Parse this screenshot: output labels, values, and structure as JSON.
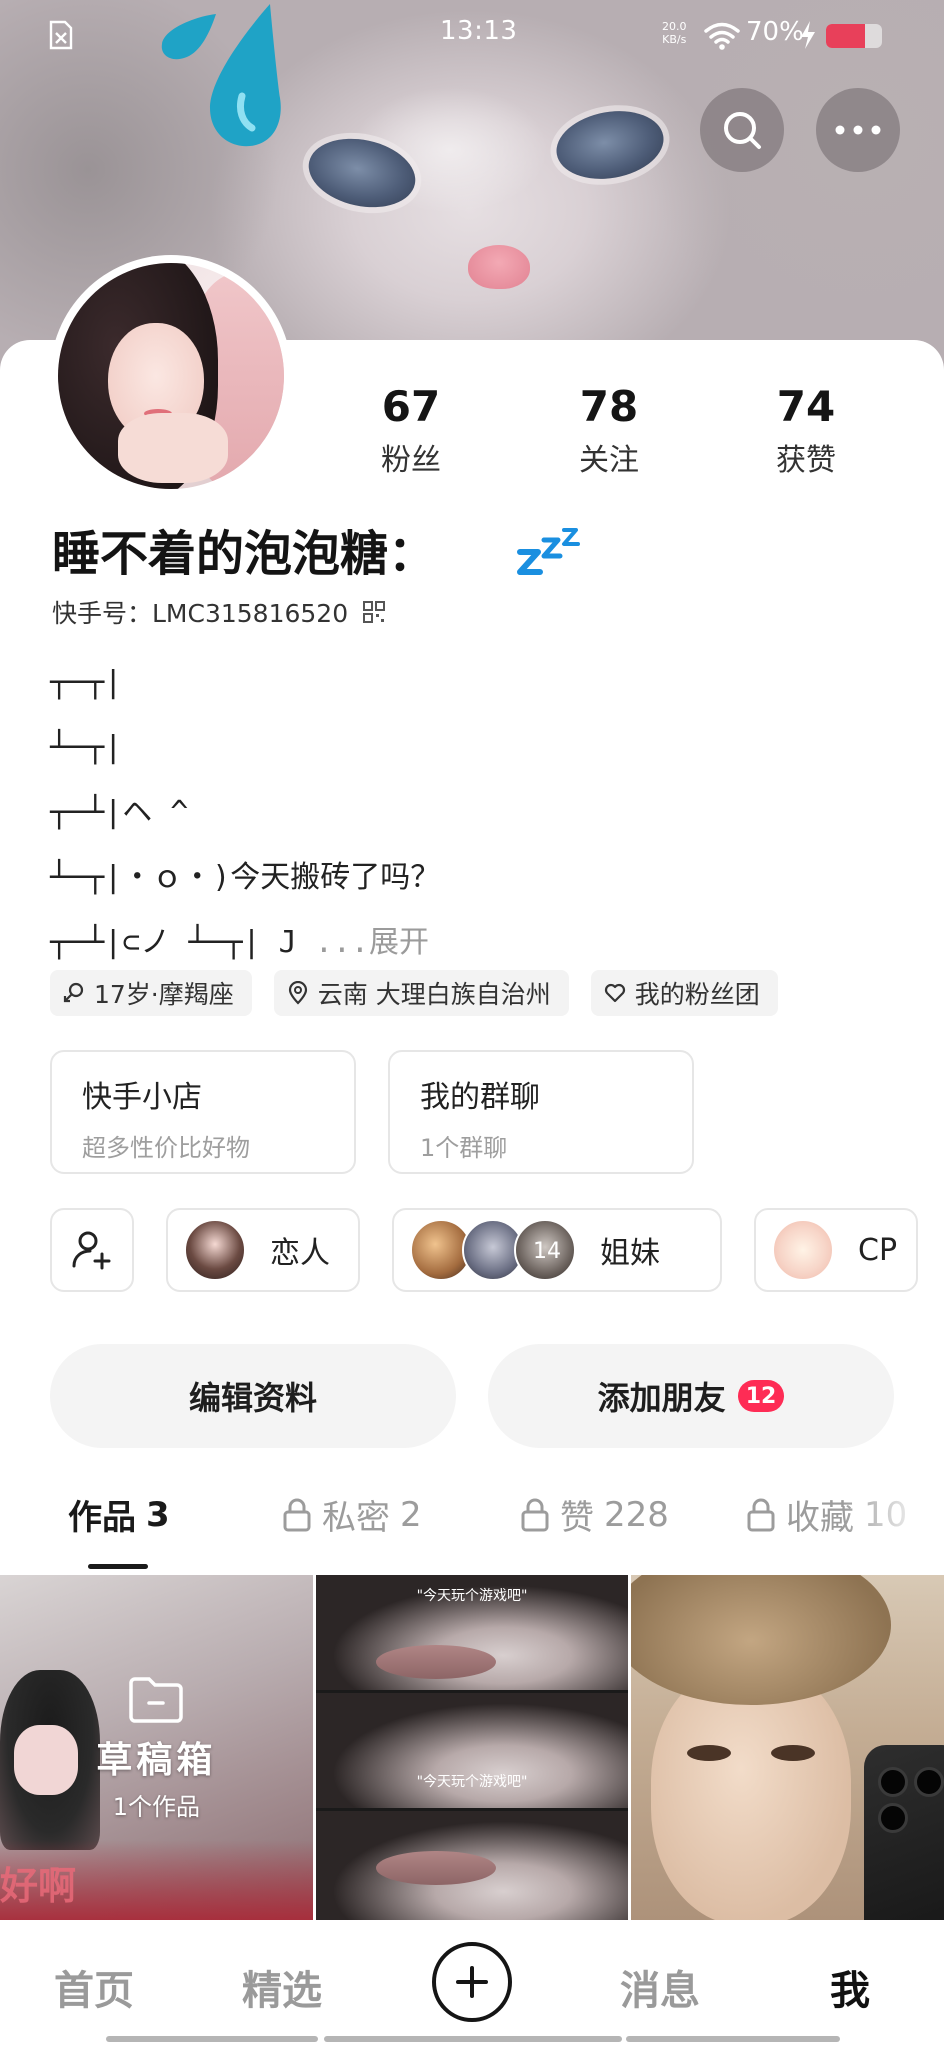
{
  "status_bar": {
    "time": "13:13",
    "net_speed_value": "20.0",
    "net_speed_unit": "KB/s",
    "battery": "70%",
    "battery_level": 0.7,
    "icons": [
      "notification-blocked-icon",
      "wifi-icon",
      "charging-bolt-icon",
      "battery-icon"
    ]
  },
  "header_actions": {
    "icons": [
      "search-icon",
      "more-icon"
    ]
  },
  "profile": {
    "nickname": "睡不着的泡泡糖：",
    "kuaishou_id": "快手号：LMC315816520",
    "stats": [
      {
        "num": "67",
        "label": "粉丝"
      },
      {
        "num": "78",
        "label": "关注"
      },
      {
        "num": "74",
        "label": "获赞"
      }
    ],
    "bio_lines": [
      "┬─┬|",
      "┴─┬|",
      "┬─┴|ヘ ^",
      "┴─┬|・ｏ・)今天搬砖了吗？",
      "┬─┴|⊂ノ ┴─┬| J"
    ],
    "bio_more": "...展开",
    "tags": [
      {
        "icon": "gender-female-icon",
        "text": "17岁·摩羯座"
      },
      {
        "icon": "location-icon",
        "text": "云南 大理白族自治州"
      },
      {
        "icon": "heart-icon",
        "text": "我的粉丝团"
      }
    ]
  },
  "features": [
    {
      "title": "快手小店",
      "sub": "超多性价比好物"
    },
    {
      "title": "我的群聊",
      "sub": "1个群聊"
    }
  ],
  "relations": {
    "lover": "恋人",
    "sisters": "姐妹",
    "sisters_count": "14",
    "cp": "CP"
  },
  "actions": {
    "edit_profile": "编辑资料",
    "add_friend": "添加朋友",
    "add_friend_badge": "12"
  },
  "tabs": [
    {
      "label": "作品",
      "count": "3",
      "locked": false
    },
    {
      "label": "私密",
      "count": "2",
      "locked": true
    },
    {
      "label": "赞",
      "count": "228",
      "locked": true
    },
    {
      "label": "收藏",
      "count": "10",
      "locked": true
    }
  ],
  "works": {
    "draft_title": "草稿箱",
    "draft_count": "1个作品",
    "sticker_text": "好啊",
    "caption": "\"今天玩个游戏吧\""
  },
  "bottom_nav": {
    "home": "首页",
    "featured": "精选",
    "messages": "消息",
    "me": "我"
  },
  "colors": {
    "accent": "#fe2c55",
    "text_primary": "#1a1a1a",
    "text_secondary": "#9c9c9c"
  }
}
